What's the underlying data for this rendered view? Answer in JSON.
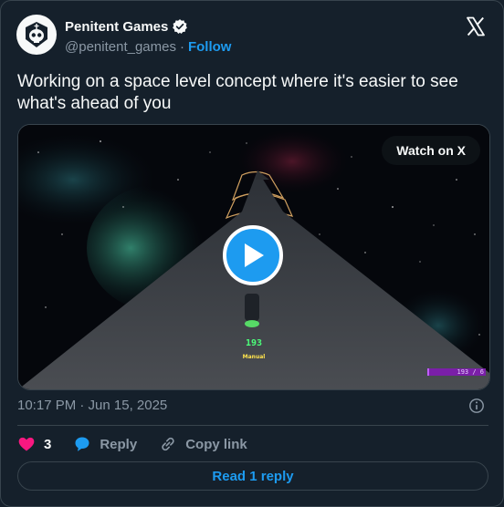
{
  "author": {
    "name": "Penitent Games",
    "handle": "@penitent_games",
    "separator": "·",
    "follow_label": "Follow",
    "verified_color": "#1d9bf0"
  },
  "icons": {
    "logo": "x-logo-icon",
    "verified": "verified-badge-icon",
    "info": "info-icon",
    "like": "heart-icon",
    "reply": "comment-bubble-icon",
    "copy": "link-icon",
    "play": "play-icon"
  },
  "tweet": {
    "text": "Working on a space level concept where it's easier to see what's ahead of you"
  },
  "media": {
    "watch_label": "Watch on X",
    "hud_score": "193",
    "hud_mode": "Manual",
    "hud_bar_text": "193 / 6"
  },
  "meta": {
    "timestamp": "10:17 PM · Jun 15, 2025"
  },
  "actions": {
    "like_count": "3",
    "reply_label": "Reply",
    "copy_label": "Copy link"
  },
  "footer": {
    "read_replies_label": "Read 1 reply"
  },
  "colors": {
    "background": "#15202b",
    "accent": "#1d9bf0",
    "like": "#f91880",
    "border": "#38444d",
    "muted": "#8b98a5"
  }
}
